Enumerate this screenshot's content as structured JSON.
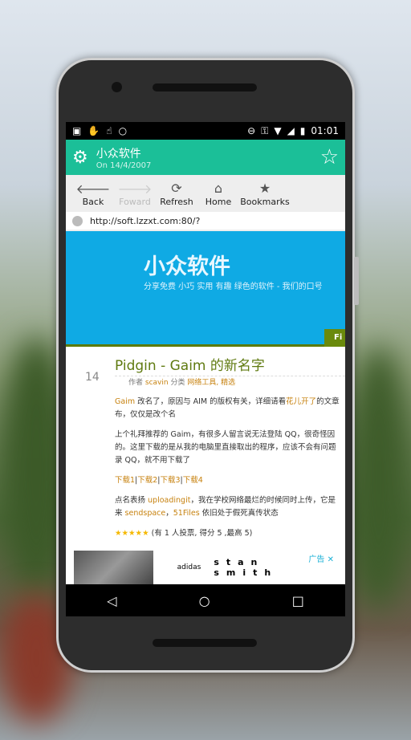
{
  "status_bar": {
    "time": "01:01"
  },
  "app_bar": {
    "title": "小众软件",
    "subtitle": "On 14/4/2007",
    "accent": "#1bbf98"
  },
  "toolbar": {
    "items": [
      {
        "label": "Back",
        "icon": "arrow-left-icon"
      },
      {
        "label": "Foward",
        "icon": "arrow-right-icon",
        "disabled": true
      },
      {
        "label": "Refresh",
        "icon": "refresh-icon"
      },
      {
        "label": "Home",
        "icon": "home-icon"
      },
      {
        "label": "Bookmarks",
        "icon": "star-icon"
      }
    ]
  },
  "url": "http://soft.lzzxt.com:80/?",
  "banner": {
    "title": "小众软件",
    "slogan": "分享免费 小巧 实用 有趣 绿色的软件 - 我们的口号",
    "button": "Fi"
  },
  "article": {
    "number": "14",
    "title": "Pidgin - Gaim 的新名字",
    "meta": {
      "author_label": "作者",
      "author": "scavin",
      "category_label": "分类",
      "categories": "网络工具, 精选"
    },
    "p1": {
      "a": "Gaim",
      "b": " 改名了，原因与 AIM 的版权有关，详细请看",
      "c": "花儿开了",
      "d": "的文章",
      "e": "布，仅仅是改个名"
    },
    "p2": [
      "上个礼拜推荐的 Gaim，有很多人留言说无法登陆 QQ，很奇怪因",
      "的。这里下载的是从我的电脑里直接取出的程序，应该不会有问题",
      "录 QQ，就不用下载了"
    ],
    "downloads": [
      "下载1",
      "下载2",
      "下载3",
      "下载4"
    ],
    "p3": {
      "a": "点名表扬 ",
      "b": "uploadingit",
      "c": "，我在学校网络最烂的时候同时上传，它是",
      "d": "来 ",
      "e": "sendspace",
      "f": "，",
      "g": "51Files",
      "h": " 依旧处于假死真传状态"
    },
    "rating": {
      "stars": 5,
      "text": "(有 1 人投票, 得分 5 ,最高 5)"
    }
  },
  "ad": {
    "brand": "adidas",
    "text": "stan smith",
    "label": "广告"
  }
}
